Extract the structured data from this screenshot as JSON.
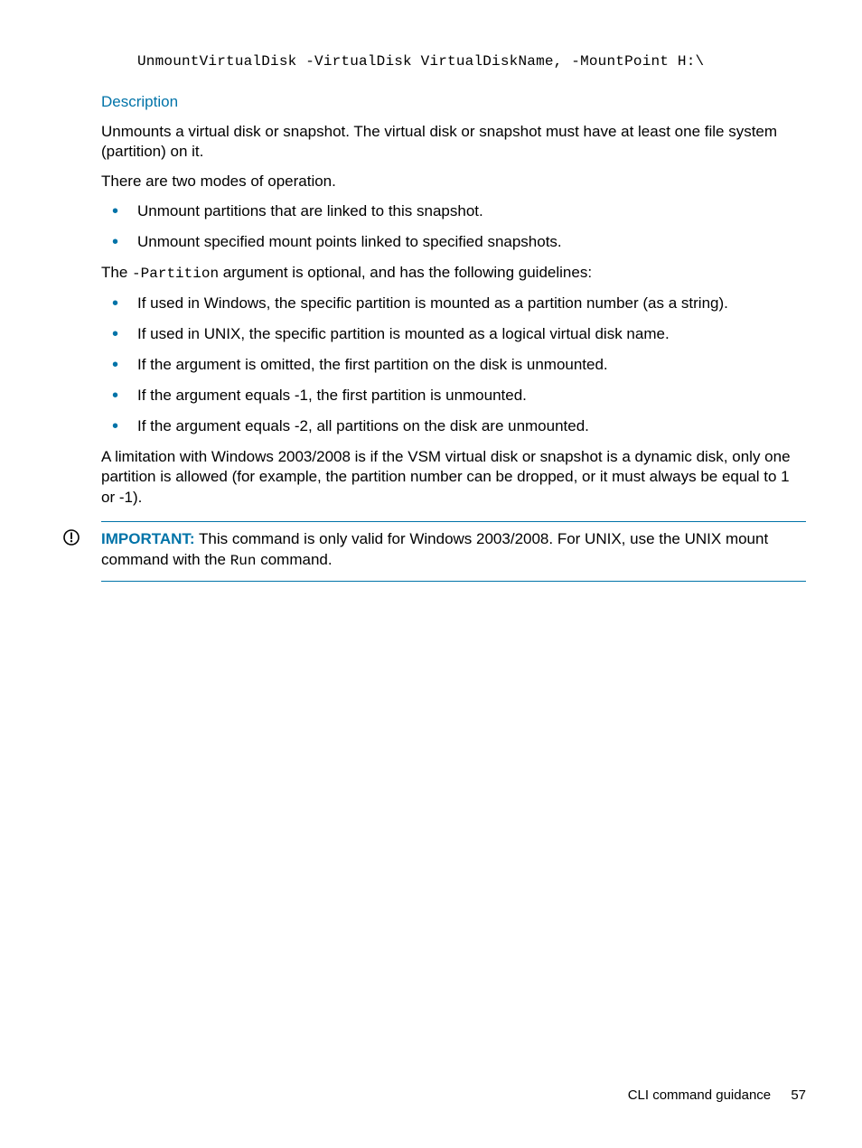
{
  "codeLine": "UnmountVirtualDisk -VirtualDisk VirtualDiskName, -MountPoint H:\\",
  "descriptionHeading": "Description",
  "para1": "Unmounts a virtual disk or snapshot. The virtual disk or snapshot must have at least one file system (partition) on it.",
  "para2": "There are two modes of operation.",
  "modes": [
    "Unmount partitions that are linked to this snapshot.",
    "Unmount specified mount points linked to specified snapshots."
  ],
  "partitionArg": {
    "prefix": "The ",
    "mono": "-Partition",
    "suffix": " argument is optional, and has the following guidelines:"
  },
  "guidelines": [
    "If used in Windows, the specific partition is mounted as a partition number (as a string).",
    "If used in UNIX, the specific partition is mounted as a logical virtual disk name.",
    "If the argument is omitted, the first partition on the disk is unmounted.",
    "If the argument equals -1, the first partition is unmounted.",
    "If the argument equals -2, all partitions on the disk are unmounted."
  ],
  "limitation": "A limitation with Windows 2003/2008 is if the VSM virtual disk or snapshot is a dynamic disk, only one partition is allowed (for example, the partition number can be dropped, or it must always be equal to 1 or -1).",
  "important": {
    "label": "IMPORTANT:",
    "prefix": "   This command is only valid for Windows 2003/2008. For UNIX, use the UNIX mount command with the ",
    "mono": "Run",
    "suffix": " command."
  },
  "footer": {
    "section": "CLI command guidance",
    "page": "57"
  }
}
